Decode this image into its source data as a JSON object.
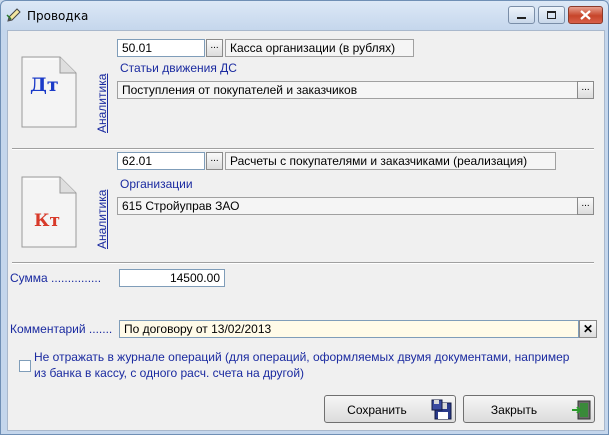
{
  "window": {
    "title": "Проводка"
  },
  "debit": {
    "badge": "Дт",
    "analytics_label": "Аналитика",
    "account_code": "50.01",
    "account_name": "Касса организации (в рублях)",
    "sub_label": "Статьи движения ДС",
    "sub_value": "Поступления от покупателей и заказчиков"
  },
  "credit": {
    "badge": "Кт",
    "analytics_label": "Аналитика",
    "account_code": "62.01",
    "account_name": "Расчеты с покупателями и заказчиками (реализация)",
    "sub_label": "Организации",
    "sub_value": "615 Стройуправ ЗАО"
  },
  "amount": {
    "label": "Сумма ...............",
    "value": "14500.00"
  },
  "comment": {
    "label": "Комментарий .......",
    "value": "По договору от 13/02/2013"
  },
  "checkbox": {
    "checked": false,
    "line1": "Не отражать в журнале операций (для операций, оформляемых двумя документами, например",
    "line2": "из банка в кассу, с одного расч. счета на другой)"
  },
  "buttons": {
    "dots": "...",
    "save": "Сохранить",
    "close": "Закрыть",
    "clear": "✕"
  },
  "colors": {
    "debit_badge": "#1a3ac8",
    "credit_badge": "#d83a2a",
    "label": "#1a2aa0"
  },
  "icons": {
    "title": "pencil-icon",
    "save": "save-floppy-icon",
    "close": "exit-door-icon"
  }
}
